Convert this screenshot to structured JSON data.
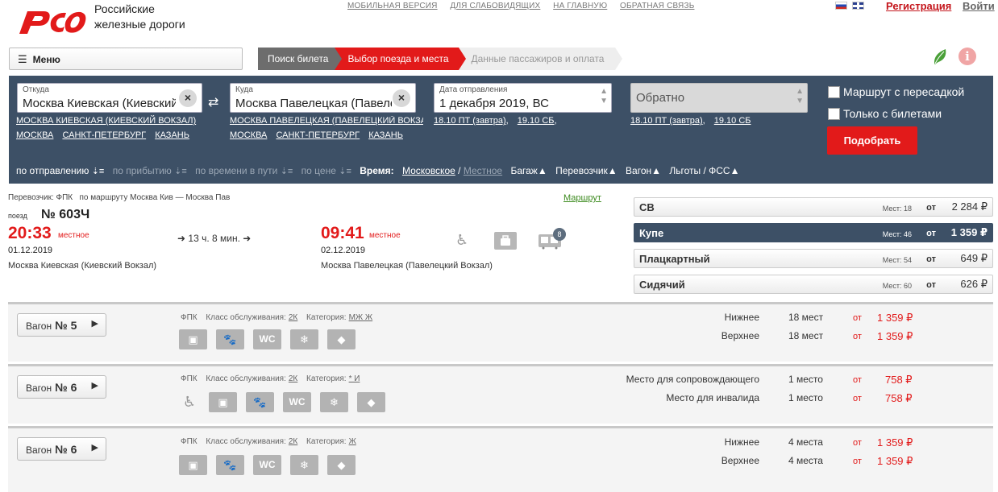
{
  "header": {
    "brand_line1": "Российские",
    "brand_line2": "железные дороги",
    "topnav": [
      "МОБИЛЬНАЯ ВЕРСИЯ",
      "ДЛЯ СЛАБОВИДЯЩИХ",
      "НА ГЛАВНУЮ",
      "ОБРАТНАЯ СВЯЗЬ"
    ],
    "register": "Регистрация",
    "login": "Войти"
  },
  "menu_label": "Меню",
  "steps": [
    "Поиск билета",
    "Выбор поезда и места",
    "Данные пассажиров и оплата"
  ],
  "search": {
    "from_label": "Откуда",
    "from_value": "Москва Киевская (Киевский вокзал)",
    "from_links1": [
      "МОСКВА КИЕВСКАЯ (КИЕВСКИЙ ВОКЗАЛ)"
    ],
    "from_links2": [
      "МОСКВА",
      "САНКТ-ПЕТЕРБУРГ",
      "КАЗАНЬ"
    ],
    "to_label": "Куда",
    "to_value": "Москва Павелецкая (Павелецкий вокзал)",
    "to_links1": [
      "МОСКВА ПАВЕЛЕЦКАЯ (ПАВЕЛЕЦКИЙ ВОКЗАЛ)"
    ],
    "to_links2": [
      "МОСКВА",
      "САНКТ-ПЕТЕРБУРГ",
      "КАЗАНЬ"
    ],
    "date_label": "Дата отправления",
    "date_value": "1 декабря 2019, ВС",
    "date_quick": [
      "18.10 ПТ (завтра)",
      "19.10 СБ"
    ],
    "return_placeholder": "Обратно",
    "return_quick": [
      "18.10 ПТ (завтра)",
      "19.10 СБ"
    ],
    "check_transfer": "Маршрут с пересадкой",
    "check_tickets": "Только с билетами",
    "find_button": "Подобрать"
  },
  "sort": {
    "by_departure": "по отправлению",
    "by_arrival": "по прибытию",
    "by_travel": "по времени в пути",
    "by_price": "по цене",
    "time_label": "Время:",
    "time_moscow": "Московское",
    "slash": "/",
    "time_local": "Местное",
    "baggage": "Багаж",
    "carrier": "Перевозчик",
    "car": "Вагон",
    "benefits": "Льготы / ФСС"
  },
  "train": {
    "carrier_line": "Перевозчик: ФПК   по маршруту Москва Кив — Москва Пав",
    "route_link": "Маршрут",
    "train_label": "поезд",
    "number": "№ 603Ч",
    "dep_time": "20:33",
    "dep_note": "местное",
    "dep_date": "01.12.2019",
    "dep_station": "Москва Киевская (Киевский Вокзал)",
    "duration": "13 ч. 8 мин.",
    "arr_time": "09:41",
    "arr_note": "местное",
    "arr_date": "02.12.2019",
    "arr_station": "Москва Павелецкая (Павелецкий Вокзал)",
    "carts_badge": "8"
  },
  "classes": [
    {
      "name": "СВ",
      "seats": "Мест: 18",
      "from": "от",
      "price": "2 284 ₽"
    },
    {
      "name": "Купе",
      "seats": "Мест: 46",
      "from": "от",
      "price": "1 359 ₽"
    },
    {
      "name": "Плацкартный",
      "seats": "Мест: 54",
      "from": "от",
      "price": "649 ₽"
    },
    {
      "name": "Сидячий",
      "seats": "Мест: 60",
      "from": "от",
      "price": "626 ₽"
    }
  ],
  "carriages": [
    {
      "label": "Вагон",
      "num": "№ 5",
      "carrier": "ФПК",
      "class_label": "Класс обслуживания:",
      "class_val": "2К",
      "cat_label": "Категория:",
      "cat_val": "МЖ Ж",
      "rows": [
        {
          "name": "Нижнее",
          "count": "18 мест",
          "from": "от",
          "price": "1 359 ₽"
        },
        {
          "name": "Верхнее",
          "count": "18 мест",
          "from": "от",
          "price": "1 359 ₽"
        }
      ]
    },
    {
      "label": "Вагон",
      "num": "№ 6",
      "carrier": "ФПК",
      "class_label": "Класс обслуживания:",
      "class_val": "2К",
      "cat_label": "Категория:",
      "cat_val": "* И",
      "rows": [
        {
          "name": "Место для сопровождающего",
          "count": "1 место",
          "from": "от",
          "price": "758 ₽"
        },
        {
          "name": "Место для инвалида",
          "count": "1 место",
          "from": "от",
          "price": "758 ₽"
        }
      ]
    },
    {
      "label": "Вагон",
      "num": "№ 6",
      "carrier": "ФПК",
      "class_label": "Класс обслуживания:",
      "class_val": "2К",
      "cat_label": "Категория:",
      "cat_val": "Ж",
      "rows": [
        {
          "name": "Нижнее",
          "count": "4 места",
          "from": "от",
          "price": "1 359 ₽"
        },
        {
          "name": "Верхнее",
          "count": "4 места",
          "from": "от",
          "price": "1 359 ₽"
        }
      ]
    }
  ],
  "icons": {
    "wc": "WC",
    "wheelchair": "♿",
    "snow": "❄"
  },
  "colors": {
    "brand_red": "#e21a1a",
    "panel": "#3d5066",
    "route_green": "#3c8a1e"
  }
}
